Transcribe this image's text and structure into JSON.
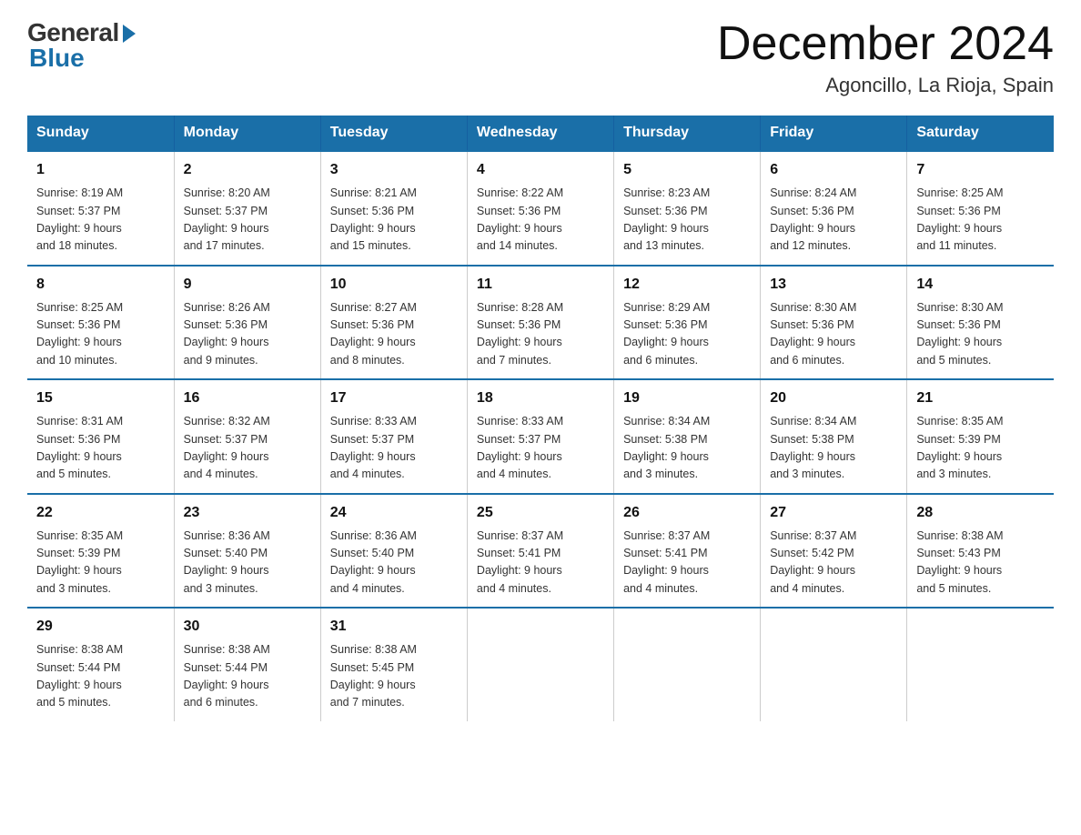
{
  "logo": {
    "general": "General",
    "blue": "Blue"
  },
  "header": {
    "month": "December 2024",
    "location": "Agoncillo, La Rioja, Spain"
  },
  "days_of_week": [
    "Sunday",
    "Monday",
    "Tuesday",
    "Wednesday",
    "Thursday",
    "Friday",
    "Saturday"
  ],
  "weeks": [
    [
      {
        "day": "1",
        "sunrise": "8:19 AM",
        "sunset": "5:37 PM",
        "daylight": "9 hours and 18 minutes."
      },
      {
        "day": "2",
        "sunrise": "8:20 AM",
        "sunset": "5:37 PM",
        "daylight": "9 hours and 17 minutes."
      },
      {
        "day": "3",
        "sunrise": "8:21 AM",
        "sunset": "5:36 PM",
        "daylight": "9 hours and 15 minutes."
      },
      {
        "day": "4",
        "sunrise": "8:22 AM",
        "sunset": "5:36 PM",
        "daylight": "9 hours and 14 minutes."
      },
      {
        "day": "5",
        "sunrise": "8:23 AM",
        "sunset": "5:36 PM",
        "daylight": "9 hours and 13 minutes."
      },
      {
        "day": "6",
        "sunrise": "8:24 AM",
        "sunset": "5:36 PM",
        "daylight": "9 hours and 12 minutes."
      },
      {
        "day": "7",
        "sunrise": "8:25 AM",
        "sunset": "5:36 PM",
        "daylight": "9 hours and 11 minutes."
      }
    ],
    [
      {
        "day": "8",
        "sunrise": "8:25 AM",
        "sunset": "5:36 PM",
        "daylight": "9 hours and 10 minutes."
      },
      {
        "day": "9",
        "sunrise": "8:26 AM",
        "sunset": "5:36 PM",
        "daylight": "9 hours and 9 minutes."
      },
      {
        "day": "10",
        "sunrise": "8:27 AM",
        "sunset": "5:36 PM",
        "daylight": "9 hours and 8 minutes."
      },
      {
        "day": "11",
        "sunrise": "8:28 AM",
        "sunset": "5:36 PM",
        "daylight": "9 hours and 7 minutes."
      },
      {
        "day": "12",
        "sunrise": "8:29 AM",
        "sunset": "5:36 PM",
        "daylight": "9 hours and 6 minutes."
      },
      {
        "day": "13",
        "sunrise": "8:30 AM",
        "sunset": "5:36 PM",
        "daylight": "9 hours and 6 minutes."
      },
      {
        "day": "14",
        "sunrise": "8:30 AM",
        "sunset": "5:36 PM",
        "daylight": "9 hours and 5 minutes."
      }
    ],
    [
      {
        "day": "15",
        "sunrise": "8:31 AM",
        "sunset": "5:36 PM",
        "daylight": "9 hours and 5 minutes."
      },
      {
        "day": "16",
        "sunrise": "8:32 AM",
        "sunset": "5:37 PM",
        "daylight": "9 hours and 4 minutes."
      },
      {
        "day": "17",
        "sunrise": "8:33 AM",
        "sunset": "5:37 PM",
        "daylight": "9 hours and 4 minutes."
      },
      {
        "day": "18",
        "sunrise": "8:33 AM",
        "sunset": "5:37 PM",
        "daylight": "9 hours and 4 minutes."
      },
      {
        "day": "19",
        "sunrise": "8:34 AM",
        "sunset": "5:38 PM",
        "daylight": "9 hours and 3 minutes."
      },
      {
        "day": "20",
        "sunrise": "8:34 AM",
        "sunset": "5:38 PM",
        "daylight": "9 hours and 3 minutes."
      },
      {
        "day": "21",
        "sunrise": "8:35 AM",
        "sunset": "5:39 PM",
        "daylight": "9 hours and 3 minutes."
      }
    ],
    [
      {
        "day": "22",
        "sunrise": "8:35 AM",
        "sunset": "5:39 PM",
        "daylight": "9 hours and 3 minutes."
      },
      {
        "day": "23",
        "sunrise": "8:36 AM",
        "sunset": "5:40 PM",
        "daylight": "9 hours and 3 minutes."
      },
      {
        "day": "24",
        "sunrise": "8:36 AM",
        "sunset": "5:40 PM",
        "daylight": "9 hours and 4 minutes."
      },
      {
        "day": "25",
        "sunrise": "8:37 AM",
        "sunset": "5:41 PM",
        "daylight": "9 hours and 4 minutes."
      },
      {
        "day": "26",
        "sunrise": "8:37 AM",
        "sunset": "5:41 PM",
        "daylight": "9 hours and 4 minutes."
      },
      {
        "day": "27",
        "sunrise": "8:37 AM",
        "sunset": "5:42 PM",
        "daylight": "9 hours and 4 minutes."
      },
      {
        "day": "28",
        "sunrise": "8:38 AM",
        "sunset": "5:43 PM",
        "daylight": "9 hours and 5 minutes."
      }
    ],
    [
      {
        "day": "29",
        "sunrise": "8:38 AM",
        "sunset": "5:44 PM",
        "daylight": "9 hours and 5 minutes."
      },
      {
        "day": "30",
        "sunrise": "8:38 AM",
        "sunset": "5:44 PM",
        "daylight": "9 hours and 6 minutes."
      },
      {
        "day": "31",
        "sunrise": "8:38 AM",
        "sunset": "5:45 PM",
        "daylight": "9 hours and 7 minutes."
      },
      null,
      null,
      null,
      null
    ]
  ],
  "labels": {
    "sunrise": "Sunrise:",
    "sunset": "Sunset:",
    "daylight": "Daylight:"
  }
}
